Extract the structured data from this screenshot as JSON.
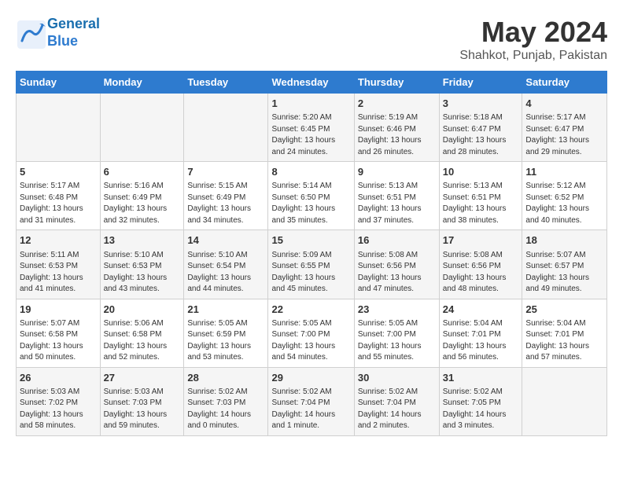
{
  "header": {
    "logo_line1": "General",
    "logo_line2": "Blue",
    "month_year": "May 2024",
    "location": "Shahkot, Punjab, Pakistan"
  },
  "days_of_week": [
    "Sunday",
    "Monday",
    "Tuesday",
    "Wednesday",
    "Thursday",
    "Friday",
    "Saturday"
  ],
  "weeks": [
    [
      {
        "day": "",
        "content": ""
      },
      {
        "day": "",
        "content": ""
      },
      {
        "day": "",
        "content": ""
      },
      {
        "day": "1",
        "content": "Sunrise: 5:20 AM\nSunset: 6:45 PM\nDaylight: 13 hours\nand 24 minutes."
      },
      {
        "day": "2",
        "content": "Sunrise: 5:19 AM\nSunset: 6:46 PM\nDaylight: 13 hours\nand 26 minutes."
      },
      {
        "day": "3",
        "content": "Sunrise: 5:18 AM\nSunset: 6:47 PM\nDaylight: 13 hours\nand 28 minutes."
      },
      {
        "day": "4",
        "content": "Sunrise: 5:17 AM\nSunset: 6:47 PM\nDaylight: 13 hours\nand 29 minutes."
      }
    ],
    [
      {
        "day": "5",
        "content": "Sunrise: 5:17 AM\nSunset: 6:48 PM\nDaylight: 13 hours\nand 31 minutes."
      },
      {
        "day": "6",
        "content": "Sunrise: 5:16 AM\nSunset: 6:49 PM\nDaylight: 13 hours\nand 32 minutes."
      },
      {
        "day": "7",
        "content": "Sunrise: 5:15 AM\nSunset: 6:49 PM\nDaylight: 13 hours\nand 34 minutes."
      },
      {
        "day": "8",
        "content": "Sunrise: 5:14 AM\nSunset: 6:50 PM\nDaylight: 13 hours\nand 35 minutes."
      },
      {
        "day": "9",
        "content": "Sunrise: 5:13 AM\nSunset: 6:51 PM\nDaylight: 13 hours\nand 37 minutes."
      },
      {
        "day": "10",
        "content": "Sunrise: 5:13 AM\nSunset: 6:51 PM\nDaylight: 13 hours\nand 38 minutes."
      },
      {
        "day": "11",
        "content": "Sunrise: 5:12 AM\nSunset: 6:52 PM\nDaylight: 13 hours\nand 40 minutes."
      }
    ],
    [
      {
        "day": "12",
        "content": "Sunrise: 5:11 AM\nSunset: 6:53 PM\nDaylight: 13 hours\nand 41 minutes."
      },
      {
        "day": "13",
        "content": "Sunrise: 5:10 AM\nSunset: 6:53 PM\nDaylight: 13 hours\nand 43 minutes."
      },
      {
        "day": "14",
        "content": "Sunrise: 5:10 AM\nSunset: 6:54 PM\nDaylight: 13 hours\nand 44 minutes."
      },
      {
        "day": "15",
        "content": "Sunrise: 5:09 AM\nSunset: 6:55 PM\nDaylight: 13 hours\nand 45 minutes."
      },
      {
        "day": "16",
        "content": "Sunrise: 5:08 AM\nSunset: 6:56 PM\nDaylight: 13 hours\nand 47 minutes."
      },
      {
        "day": "17",
        "content": "Sunrise: 5:08 AM\nSunset: 6:56 PM\nDaylight: 13 hours\nand 48 minutes."
      },
      {
        "day": "18",
        "content": "Sunrise: 5:07 AM\nSunset: 6:57 PM\nDaylight: 13 hours\nand 49 minutes."
      }
    ],
    [
      {
        "day": "19",
        "content": "Sunrise: 5:07 AM\nSunset: 6:58 PM\nDaylight: 13 hours\nand 50 minutes."
      },
      {
        "day": "20",
        "content": "Sunrise: 5:06 AM\nSunset: 6:58 PM\nDaylight: 13 hours\nand 52 minutes."
      },
      {
        "day": "21",
        "content": "Sunrise: 5:05 AM\nSunset: 6:59 PM\nDaylight: 13 hours\nand 53 minutes."
      },
      {
        "day": "22",
        "content": "Sunrise: 5:05 AM\nSunset: 7:00 PM\nDaylight: 13 hours\nand 54 minutes."
      },
      {
        "day": "23",
        "content": "Sunrise: 5:05 AM\nSunset: 7:00 PM\nDaylight: 13 hours\nand 55 minutes."
      },
      {
        "day": "24",
        "content": "Sunrise: 5:04 AM\nSunset: 7:01 PM\nDaylight: 13 hours\nand 56 minutes."
      },
      {
        "day": "25",
        "content": "Sunrise: 5:04 AM\nSunset: 7:01 PM\nDaylight: 13 hours\nand 57 minutes."
      }
    ],
    [
      {
        "day": "26",
        "content": "Sunrise: 5:03 AM\nSunset: 7:02 PM\nDaylight: 13 hours\nand 58 minutes."
      },
      {
        "day": "27",
        "content": "Sunrise: 5:03 AM\nSunset: 7:03 PM\nDaylight: 13 hours\nand 59 minutes."
      },
      {
        "day": "28",
        "content": "Sunrise: 5:02 AM\nSunset: 7:03 PM\nDaylight: 14 hours\nand 0 minutes."
      },
      {
        "day": "29",
        "content": "Sunrise: 5:02 AM\nSunset: 7:04 PM\nDaylight: 14 hours\nand 1 minute."
      },
      {
        "day": "30",
        "content": "Sunrise: 5:02 AM\nSunset: 7:04 PM\nDaylight: 14 hours\nand 2 minutes."
      },
      {
        "day": "31",
        "content": "Sunrise: 5:02 AM\nSunset: 7:05 PM\nDaylight: 14 hours\nand 3 minutes."
      },
      {
        "day": "",
        "content": ""
      }
    ]
  ]
}
